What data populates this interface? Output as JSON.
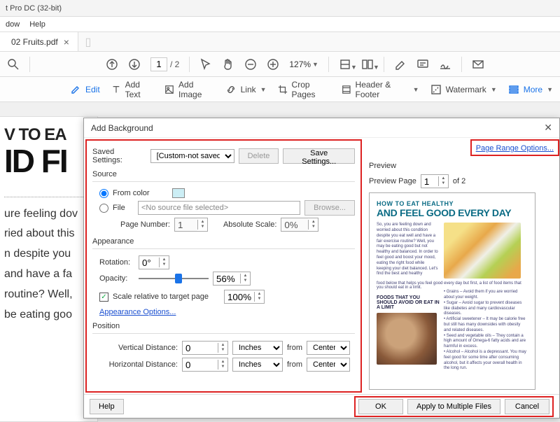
{
  "app": {
    "title": "t Pro DC (32-bit)"
  },
  "menubar": {
    "item0": "dow",
    "item1": "Help"
  },
  "tab": {
    "name": "02 Fruits.pdf"
  },
  "pager": {
    "current": "1",
    "total": "/ 2"
  },
  "zoom": {
    "value": "127%"
  },
  "edittb": {
    "edit": "Edit",
    "addtext": "Add Text",
    "addimage": "Add Image",
    "link": "Link",
    "crop": "Crop Pages",
    "header": "Header & Footer",
    "watermark": "Watermark",
    "more": "More"
  },
  "doc": {
    "h2": "V TO EA",
    "h1": "ID FI",
    "body1": "ure feeling dov",
    "body2": "ried about this",
    "body3": "n despite you",
    "body4": "and have a fa",
    "body5": "routine? Well,",
    "body6": " be eating goo"
  },
  "dlg": {
    "title": "Add Background",
    "saved_lbl": "Saved Settings:",
    "saved_val": "[Custom-not saved]",
    "delete": "Delete",
    "savesettings": "Save Settings...",
    "pagerange": "Page Range Options...",
    "source": "Source",
    "fromcolor": "From color",
    "file": "File",
    "nofile": "<No source file selected>",
    "browse": "Browse...",
    "pagenum_lbl": "Page Number:",
    "pagenum_val": "1",
    "abscale_lbl": "Absolute Scale:",
    "abscale_val": "0%",
    "appearance": "Appearance",
    "rotation_lbl": "Rotation:",
    "rotation_val": "0°",
    "opacity_lbl": "Opacity:",
    "opacity_val": "56%",
    "scale_lbl": "Scale relative to target page",
    "scale_val": "100%",
    "appopt": "Appearance Options...",
    "position": "Position",
    "vdist": "Vertical Distance:",
    "hdist": "Horizontal Distance:",
    "distval": "0",
    "unit": "Inches",
    "from": "from",
    "center": "Center",
    "preview": "Preview",
    "previewpg": "Preview Page",
    "pv_val": "1",
    "pv_of": "of 2",
    "help": "Help",
    "ok": "OK",
    "apply": "Apply to Multiple Files",
    "cancel": "Cancel"
  },
  "pv": {
    "h1": "HOW TO EAT HEALTHY",
    "h2": "AND FEEL GOOD EVERY DAY",
    "sub": "FOODS THAT YOU SHOULD AVOID OR EAT IN A LIMIT"
  }
}
